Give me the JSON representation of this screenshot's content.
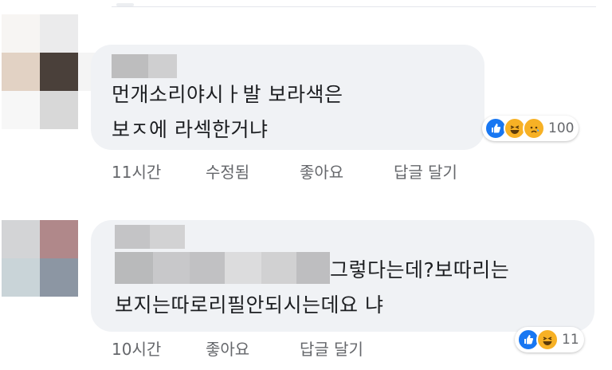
{
  "comments": [
    {
      "text_line1": "먼개소리야시ㅏ발 보라색은",
      "text_line2": "보ㅈ에 라섹한거냐",
      "reactions": {
        "icons": [
          "like-icon",
          "haha-icon",
          "sad-icon"
        ],
        "count": "100"
      },
      "actions": {
        "time": "11시간",
        "edited": "수정됨",
        "like": "좋아요",
        "reply": "답글 달기"
      }
    },
    {
      "text_line1": "그렇다는데?보따리는",
      "text_line2": "보지는따로리필안되시는데요 냐",
      "reactions": {
        "icons": [
          "like-icon",
          "haha-icon"
        ],
        "count": "11"
      },
      "actions": {
        "time": "10시간",
        "like": "좋아요",
        "reply": "답글 달기"
      }
    }
  ],
  "colors": {
    "bubble": "#f0f2f5",
    "like": "#1877f2",
    "emoji": "#f7b125",
    "meta": "#65676b"
  }
}
